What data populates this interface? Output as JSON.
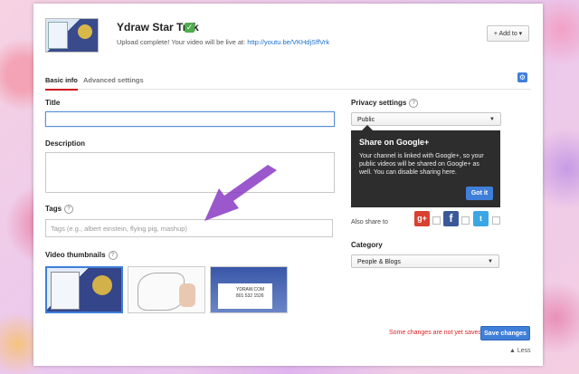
{
  "video": {
    "title": "Ydraw Star Trek",
    "status_prefix": "Upload complete! Your video will be live at:",
    "url": "http://youtu.be/VKHdjSffVrk",
    "add_to": "Add to"
  },
  "tabs": [
    {
      "label": "Basic info",
      "active": true
    },
    {
      "label": "Advanced settings",
      "active": false
    }
  ],
  "form": {
    "title_label": "Title",
    "description_label": "Description",
    "tags_label": "Tags",
    "tags_placeholder": "Tags (e.g., albert einstein, flying pig, mashup)",
    "thumbnails_label": "Video thumbnails"
  },
  "privacy": {
    "label": "Privacy settings",
    "value": "Public",
    "tooltip_title": "Share on Google+",
    "tooltip_body": "Your channel is linked with Google+, so your public videos will be shared on Google+ as well. You can disable sharing here.",
    "got_it": "Got it",
    "also_share": "Also share to"
  },
  "category": {
    "label": "Category",
    "value": "People & Blogs"
  },
  "footer": {
    "unsaved": "Some changes are not yet saved.",
    "save": "Save changes",
    "less": "Less"
  },
  "thumb3_text": "YDRAW.COM 801 532 1526",
  "colors": {
    "accent": "#3f7fd9",
    "arrow": "#8a3bc4",
    "warning": "#dd2222"
  }
}
